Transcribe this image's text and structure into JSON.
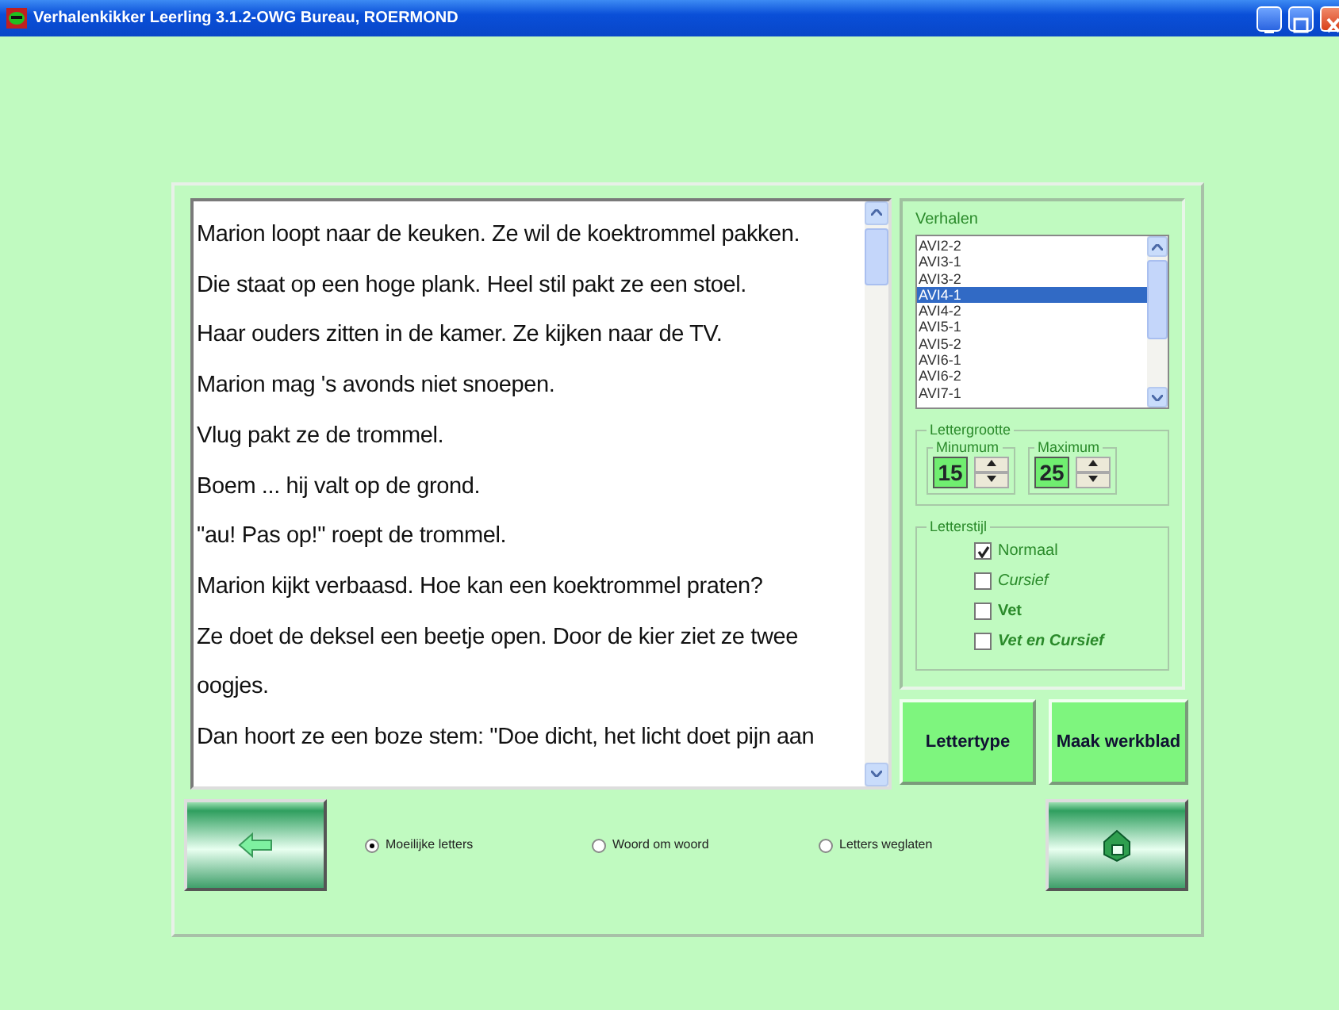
{
  "window": {
    "title": "Verhalenkikker Leerling  3.1.2-OWG Bureau, ROERMOND"
  },
  "story": {
    "lines": [
      "Marion loopt naar de keuken. Ze wil de koektrommel pakken.",
      "Die staat op een hoge plank. Heel stil pakt ze een stoel.",
      "Haar ouders zitten in de kamer. Ze kijken naar de TV.",
      "Marion mag 's avonds niet snoepen.",
      "Vlug pakt ze de trommel.",
      "Boem ... hij valt op de grond.",
      "\"au! Pas op!\" roept de trommel.",
      "Marion kijkt verbaasd. Hoe kan een koektrommel praten?",
      "Ze doet de deksel een beetje open. Door de kier ziet ze twee",
      "oogjes.",
      "Dan hoort ze een boze stem: \"Doe dicht, het licht doet pijn aan"
    ]
  },
  "verhalen": {
    "label": "Verhalen",
    "items": [
      {
        "label": "AVI2-2",
        "selected": false
      },
      {
        "label": "AVI3-1",
        "selected": false
      },
      {
        "label": "AVI3-2",
        "selected": false
      },
      {
        "label": "AVI4-1",
        "selected": true
      },
      {
        "label": "AVI4-2",
        "selected": false
      },
      {
        "label": "AVI5-1",
        "selected": false
      },
      {
        "label": "AVI5-2",
        "selected": false
      },
      {
        "label": "AVI6-1",
        "selected": false
      },
      {
        "label": "AVI6-2",
        "selected": false
      },
      {
        "label": "AVI7-1",
        "selected": false
      }
    ]
  },
  "lettergrootte": {
    "label": "Lettergrootte",
    "spinners": [
      {
        "label": "Minumum",
        "value": "15"
      },
      {
        "label": "Maximum",
        "value": "25"
      }
    ]
  },
  "letterstijl": {
    "label": "Letterstijl",
    "options": [
      {
        "label": "Normaal",
        "kind": "normal",
        "checked": true
      },
      {
        "label": "Cursief",
        "kind": "italic",
        "checked": false
      },
      {
        "label": "Vet",
        "kind": "bold",
        "checked": false
      },
      {
        "label": "Vet en Cursief",
        "kind": "bolditalic",
        "checked": false
      }
    ]
  },
  "buttons": [
    "Lettertype",
    "Maak werkblad"
  ],
  "modes": [
    {
      "label": "Moeilijke letters",
      "selected": true
    },
    {
      "label": "Woord om woord",
      "selected": false
    },
    {
      "label": "Letters weglaten",
      "selected": false
    }
  ]
}
